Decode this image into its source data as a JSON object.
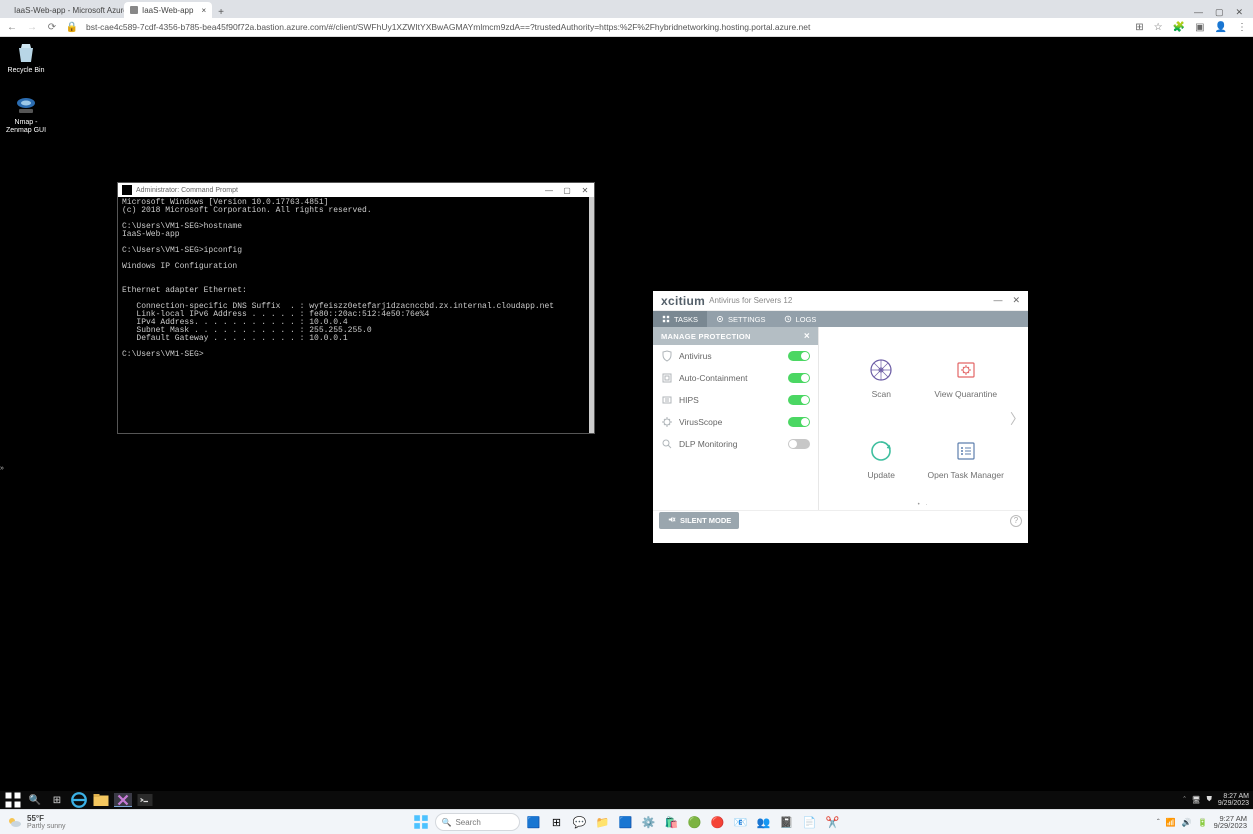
{
  "browser": {
    "tab1": "IaaS-Web-app - Microsoft Azure",
    "tab2": "IaaS-Web-app",
    "url": "bst-cae4c589-7cdf-4356-b785-bea45f90f72a.bastion.azure.com/#/client/SWFhUy1XZWItYXBwAGMAYmlmcm9zdA==?trustedAuthority=https:%2F%2Fhybridnetworking.hosting.portal.azure.net",
    "min": "—",
    "max": "▢",
    "close": "✕"
  },
  "desktop_icons": {
    "recycle": "Recycle Bin",
    "nmap": "Nmap -\nZenmap GUI"
  },
  "cmd": {
    "title": "Administrator: Command Prompt",
    "body": "Microsoft Windows [Version 10.0.17763.4851]\n(c) 2018 Microsoft Corporation. All rights reserved.\n\nC:\\Users\\VM1-SEG>hostname\nIaaS-Web-app\n\nC:\\Users\\VM1-SEG>ipconfig\n\nWindows IP Configuration\n\n\nEthernet adapter Ethernet:\n\n   Connection-specific DNS Suffix  . : wyfeiszz0etefarj1dzacnccbd.zx.internal.cloudapp.net\n   Link-local IPv6 Address . . . . . : fe80::20ac:512:4e50:76e%4\n   IPv4 Address. . . . . . . . . . . : 10.0.0.4\n   Subnet Mask . . . . . . . . . . . : 255.255.255.0\n   Default Gateway . . . . . . . . . : 10.0.0.1\n\nC:\\Users\\VM1-SEG>"
  },
  "xcitium": {
    "brand": "xcitium",
    "suite": "Antivirus for Servers  12",
    "tabs": {
      "tasks": "TASKS",
      "settings": "SETTINGS",
      "logs": "LOGS"
    },
    "panel_title": "MANAGE PROTECTION",
    "items": {
      "antivirus": "Antivirus",
      "autocontain": "Auto-Containment",
      "hips": "HIPS",
      "viruscope": "VirusScope",
      "dlp": "DLP Monitoring"
    },
    "tiles": {
      "scan": "Scan",
      "quarantine": "View Quarantine",
      "update": "Update",
      "taskmgr": "Open Task Manager"
    },
    "silent": "SILENT MODE"
  },
  "remote_tray": {
    "time": "8:27 AM",
    "date": "9/29/2023"
  },
  "host": {
    "temp": "55°F",
    "weather": "Partly sunny",
    "search": "Search",
    "time": "9:27 AM",
    "date": "9/29/2023"
  }
}
